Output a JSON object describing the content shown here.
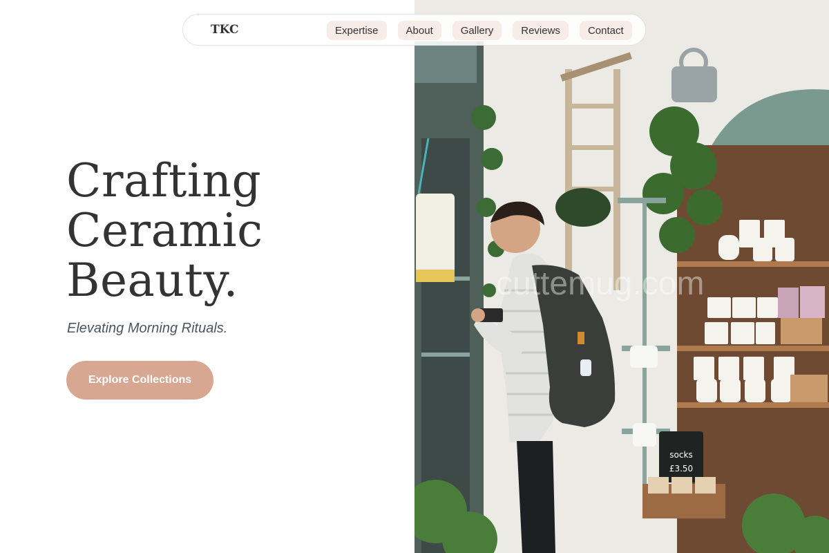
{
  "nav": {
    "logo": "TKC",
    "links": [
      {
        "label": "Expertise"
      },
      {
        "label": "About"
      },
      {
        "label": "Gallery"
      },
      {
        "label": "Reviews"
      },
      {
        "label": "Contact"
      }
    ]
  },
  "hero": {
    "title_lines": [
      "Crafting",
      "Ceramic",
      "Beauty."
    ],
    "subtitle": "Elevating Morning Rituals.",
    "cta_label": "Explore Collections"
  },
  "photo": {
    "watermark": "cuttemug.com",
    "chalkboard_line1": "socks",
    "chalkboard_line2": "£3.50"
  },
  "colors": {
    "accent": "#d8a791",
    "nav_pill": "#f8ece8",
    "text_dark": "#333333",
    "subtitle": "#4a5560",
    "cabinet_green": "#7a9a8f"
  }
}
